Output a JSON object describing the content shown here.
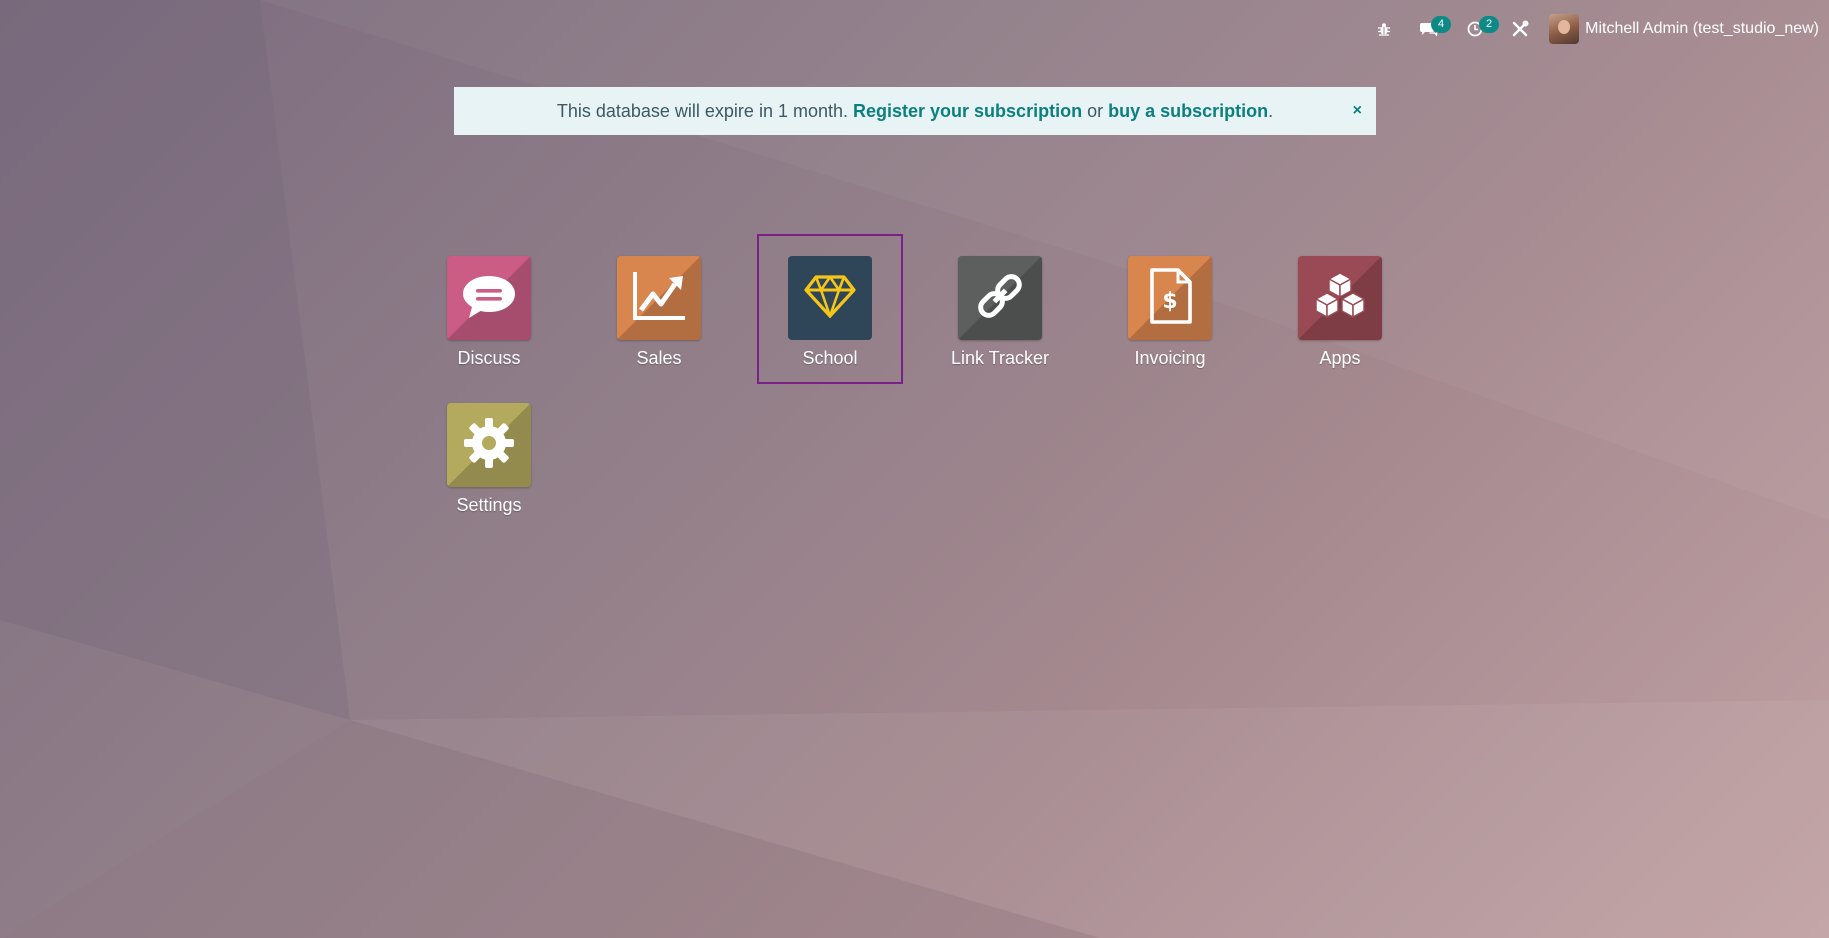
{
  "colors": {
    "brand_teal": "#0c7f80",
    "badge_bg": "#0e8a86",
    "focus_border": "#7c1f86",
    "banner_bg": "#e7f3f5"
  },
  "topbar": {
    "debug_icon": "bug-icon",
    "messages": {
      "icon": "chat-bubbles-icon",
      "count": "4"
    },
    "activities": {
      "icon": "clock-icon",
      "count": "2"
    },
    "studio_icon": "tools-icon",
    "user": {
      "name": "Mitchell Admin (test_studio_new)",
      "avatar": "user-avatar"
    }
  },
  "banner": {
    "text": "This database will expire in 1 month.",
    "register_link": "Register your subscription",
    "or": "or",
    "buy_link": "buy a subscription",
    "period": ".",
    "close": "×"
  },
  "apps": [
    {
      "label": "Discuss",
      "icon": "chat-bubble-icon",
      "color": "#cb5d84"
    },
    {
      "label": "Sales",
      "icon": "trend-chart-icon",
      "color": "#d9854e"
    },
    {
      "label": "School",
      "icon": "diamond-icon",
      "color": "#2f4659",
      "focused": true
    },
    {
      "label": "Link Tracker",
      "icon": "chain-link-icon",
      "color": "#5d5e5e"
    },
    {
      "label": "Invoicing",
      "icon": "invoice-dollar-icon",
      "color": "#d9854e"
    },
    {
      "label": "Apps",
      "icon": "cubes-icon",
      "color": "#9a4a54"
    },
    {
      "label": "Settings",
      "icon": "gear-icon",
      "color": "#b3aa5e"
    }
  ]
}
